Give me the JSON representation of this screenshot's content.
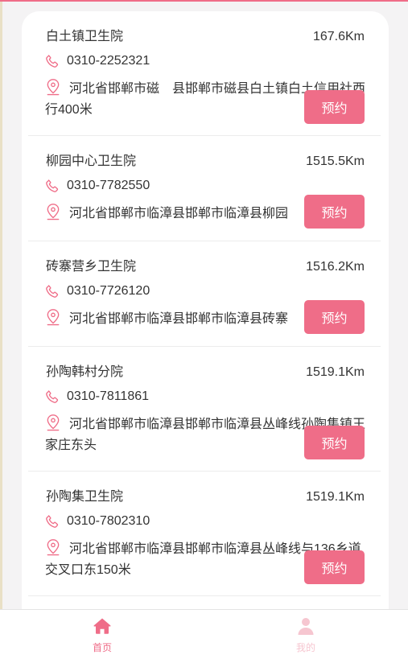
{
  "colors": {
    "accent": "#ef6d88",
    "accent_light": "#f6c6d0",
    "background": "#f4f3f4"
  },
  "hospitals": [
    {
      "name": "白土镇卫生院",
      "distance": "167.6Km",
      "phone": "0310-2252321",
      "address": "河北省邯郸市磁　县邯郸市磁县白土镇白土信用社西行400米",
      "book_label": "预约"
    },
    {
      "name": "柳园中心卫生院",
      "distance": "1515.5Km",
      "phone": "0310-7782550",
      "address": "河北省邯郸市临漳县邯郸市临漳县柳园",
      "book_label": "预约"
    },
    {
      "name": "砖寨营乡卫生院",
      "distance": "1516.2Km",
      "phone": "0310-7726120",
      "address": "河北省邯郸市临漳县邯郸市临漳县砖寨",
      "book_label": "预约"
    },
    {
      "name": "孙陶韩村分院",
      "distance": "1519.1Km",
      "phone": "0310-7811861",
      "address": "河北省邯郸市临漳县邯郸市临漳县丛峰线孙陶集镇王家庄东头",
      "book_label": "预约"
    },
    {
      "name": "孙陶集卫生院",
      "distance": "1519.1Km",
      "phone": "0310-7802310",
      "address": "河北省邯郸市临漳县邯郸市临漳县丛峰线与136乡道交叉口东150米",
      "book_label": "预约"
    }
  ],
  "tabbar": {
    "home": {
      "label": "首页",
      "icon": "home-icon"
    },
    "mine": {
      "label": "我的",
      "icon": "user-icon"
    }
  }
}
